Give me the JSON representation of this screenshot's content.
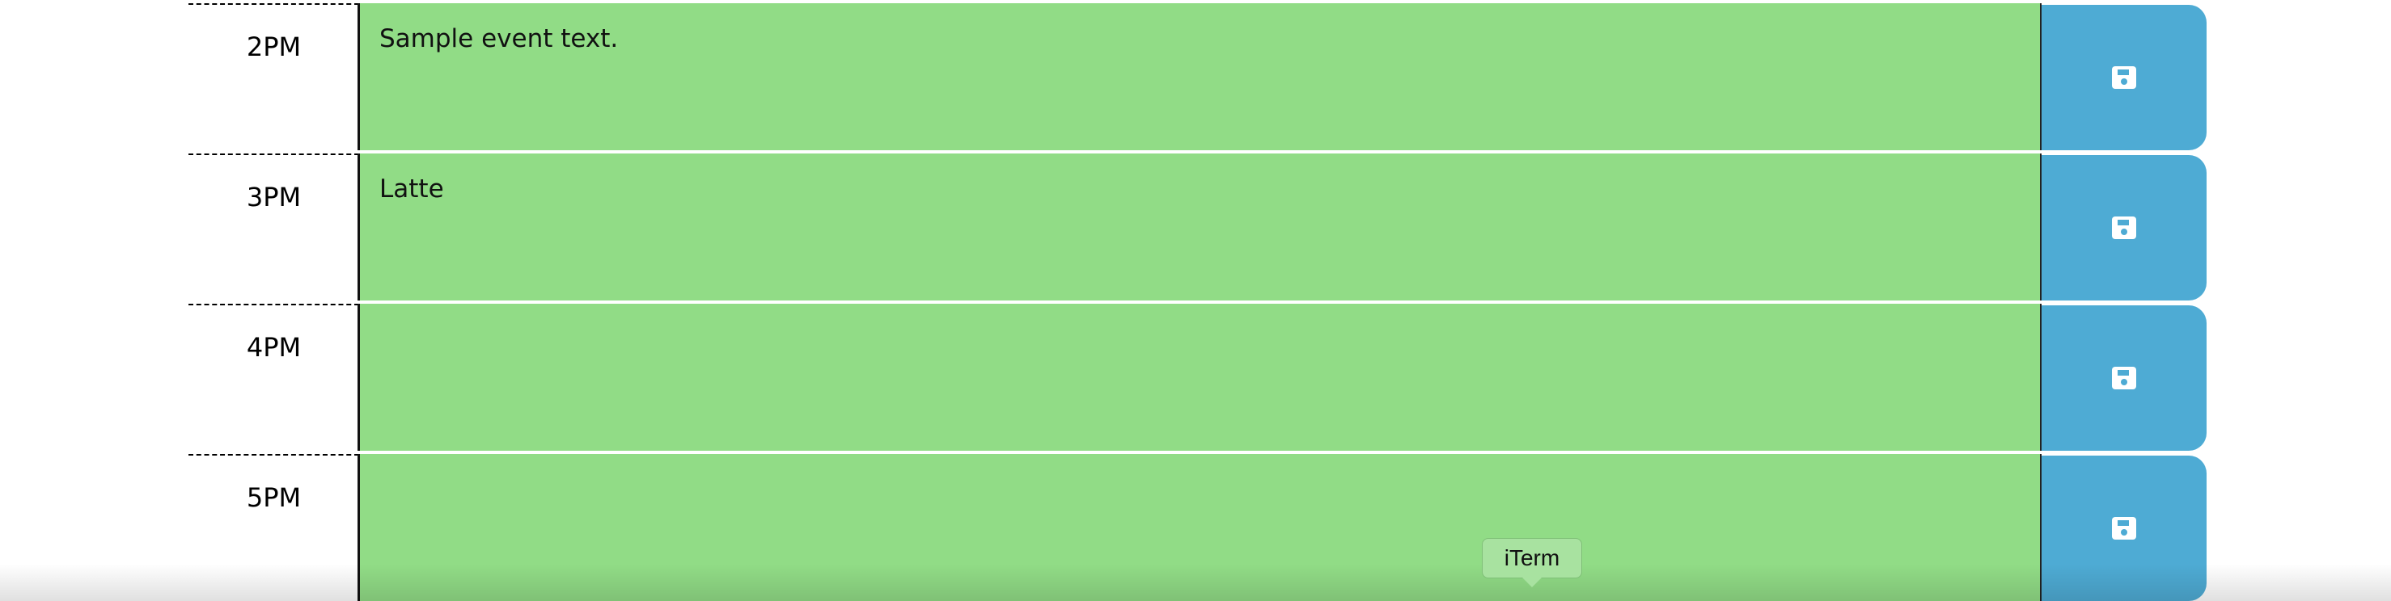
{
  "timeblocks": [
    {
      "hour_label": "2PM",
      "event_text": "Sample event text."
    },
    {
      "hour_label": "3PM",
      "event_text": "Latte"
    },
    {
      "hour_label": "4PM",
      "event_text": ""
    },
    {
      "hour_label": "5PM",
      "event_text": ""
    }
  ],
  "dock_tooltip": {
    "label": "iTerm"
  },
  "colors": {
    "event_background": "#91dc86",
    "save_button": "#4eabd4"
  },
  "icons": {
    "save": "floppy-disk-icon"
  }
}
